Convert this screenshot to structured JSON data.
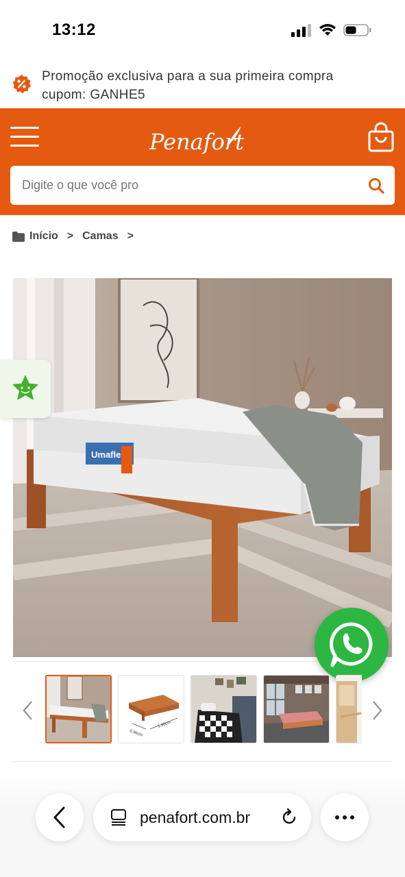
{
  "status_bar": {
    "time": "13:12"
  },
  "promo": {
    "line1": "Promoção exclusiva para a sua primeira compra",
    "line2": "cupom: GANHE5",
    "icon": "percent-badge-icon"
  },
  "header": {
    "logo": "Penafort",
    "brand_color": "#e55a11",
    "search": {
      "placeholder": "Digite o que você pro",
      "value": ""
    }
  },
  "breadcrumb": {
    "items": [
      "Início",
      "Camas"
    ],
    "separator": ">"
  },
  "gallery": {
    "thumbnails": [
      {
        "name": "thumb-bed-mattress",
        "active": true
      },
      {
        "name": "thumb-bed-dimensions",
        "active": false
      },
      {
        "name": "thumb-bed-checkered",
        "active": false
      },
      {
        "name": "thumb-bed-loft",
        "active": false
      },
      {
        "name": "thumb-bed-wood-detail",
        "active": false
      }
    ],
    "dimension_labels": [
      "0,96cm",
      "1,98cm"
    ]
  },
  "mattress_brand": "Umaflex",
  "browser": {
    "url": "penafort.com.br",
    "whatsapp_color": "#2db742"
  }
}
